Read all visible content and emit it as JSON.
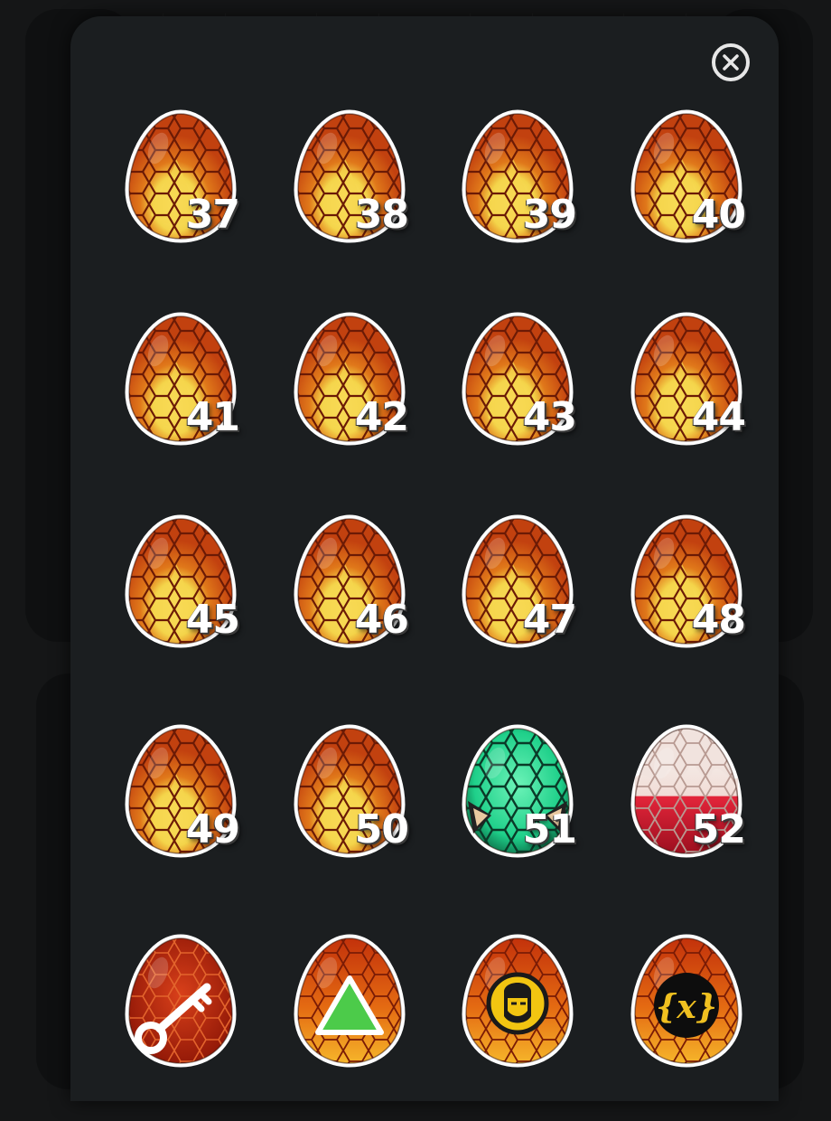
{
  "eggs": [
    {
      "number": "37",
      "variant": "fire"
    },
    {
      "number": "38",
      "variant": "fire"
    },
    {
      "number": "39",
      "variant": "fire"
    },
    {
      "number": "40",
      "variant": "fire"
    },
    {
      "number": "41",
      "variant": "fire"
    },
    {
      "number": "42",
      "variant": "fire"
    },
    {
      "number": "43",
      "variant": "fire"
    },
    {
      "number": "44",
      "variant": "fire"
    },
    {
      "number": "45",
      "variant": "fire"
    },
    {
      "number": "46",
      "variant": "fire"
    },
    {
      "number": "47",
      "variant": "fire"
    },
    {
      "number": "48",
      "variant": "fire"
    },
    {
      "number": "49",
      "variant": "fire"
    },
    {
      "number": "50",
      "variant": "fire"
    },
    {
      "number": "51",
      "variant": "green"
    },
    {
      "number": "52",
      "variant": "red-drip"
    }
  ],
  "special_eggs": [
    {
      "icon": "key-icon",
      "variant": "red"
    },
    {
      "icon": "green-triangle-icon",
      "variant": "orange"
    },
    {
      "icon": "helmet-face-badge-icon",
      "variant": "orange"
    },
    {
      "icon": "curly-x-badge-icon",
      "variant": "orange",
      "text": "{x}"
    }
  ],
  "close": {
    "icon": "close-icon"
  },
  "colors": {
    "fire_shell": "#c2410f",
    "fire_glow": "#f4d44a",
    "green_shell": "#1fd08a",
    "red_shell": "#e3253a",
    "modal_bg": "#1b1e20",
    "page_bg": "#151617"
  }
}
